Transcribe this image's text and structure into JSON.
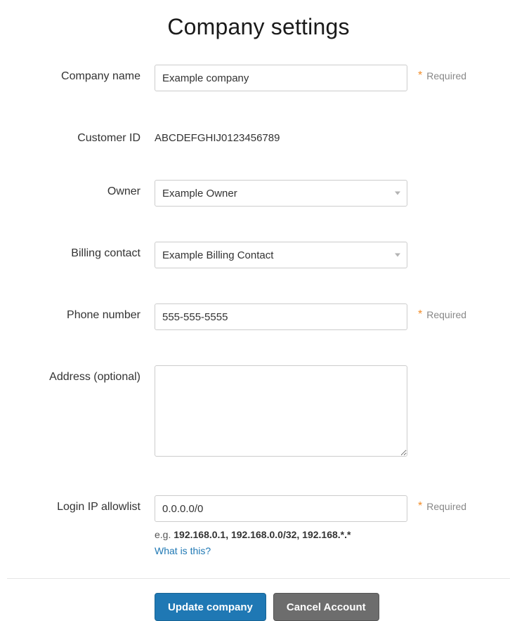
{
  "page": {
    "title": "Company settings"
  },
  "fields": {
    "company_name": {
      "label": "Company name",
      "value": "Example company",
      "required_label": "Required"
    },
    "customer_id": {
      "label": "Customer ID",
      "value": "ABCDEFGHIJ0123456789"
    },
    "owner": {
      "label": "Owner",
      "value": "Example Owner"
    },
    "billing_contact": {
      "label": "Billing contact",
      "value": "Example Billing Contact"
    },
    "phone_number": {
      "label": "Phone number",
      "value": "555-555-5555",
      "required_label": "Required"
    },
    "address": {
      "label": "Address (optional)",
      "value": ""
    },
    "login_ip_allowlist": {
      "label": "Login IP allowlist",
      "value": "0.0.0.0/0",
      "required_label": "Required",
      "hint_prefix": "e.g. ",
      "hint_example": "192.168.0.1, 192.168.0.0/32, 192.168.*.*",
      "hint_link": "What is this?"
    }
  },
  "required_star": "*",
  "buttons": {
    "update": "Update company",
    "cancel": "Cancel Account"
  }
}
